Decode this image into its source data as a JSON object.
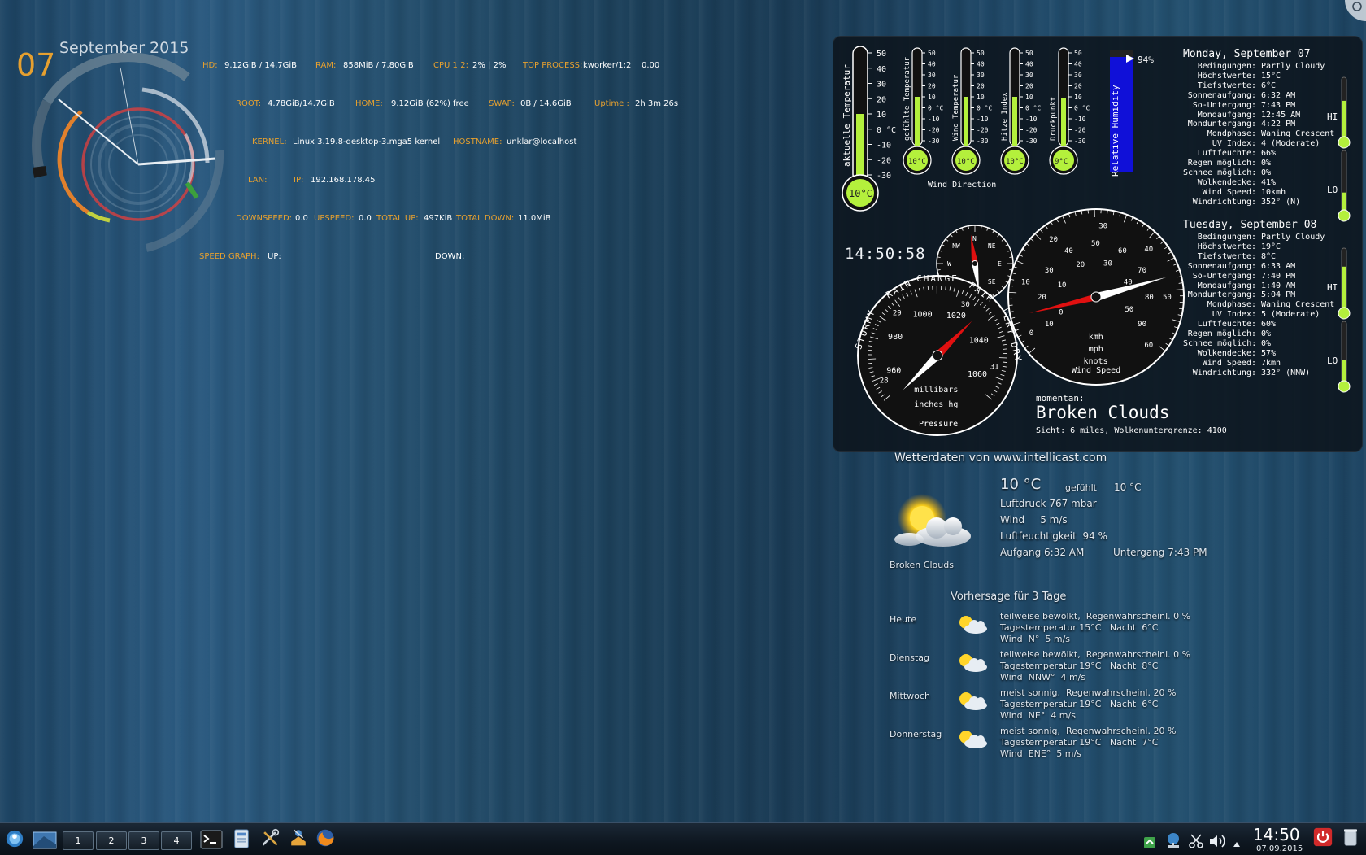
{
  "desktop": {
    "calendar": {
      "day": "07",
      "month_year": "September 2015"
    },
    "sysinfo": {
      "row1": [
        {
          "label": "HD:",
          "value": "9.12GiB / 14.7GiB"
        },
        {
          "label": "RAM:",
          "value": "858MiB / 7.80GiB"
        },
        {
          "label": "CPU 1|2:",
          "value": "2% | 2%"
        },
        {
          "label": "TOP PROCESS:",
          "value": "kworker/1:2",
          "extra": "0.00"
        }
      ],
      "row2": [
        {
          "label": "ROOT:",
          "value": "4.78GiB/14.7GiB"
        },
        {
          "label": "HOME:",
          "value": "9.12GiB (62%) free"
        },
        {
          "label": "SWAP:",
          "value": "0B / 14.6GiB"
        },
        {
          "label": "Uptime :",
          "value": "2h 3m 26s"
        }
      ],
      "row3": [
        {
          "label": "KERNEL:",
          "value": "Linux 3.19.8-desktop-3.mga5 kernel"
        },
        {
          "label": "HOSTNAME:",
          "value": "unklar@localhost"
        }
      ],
      "row4": [
        {
          "label": "LAN:",
          "value": ""
        },
        {
          "label": "IP:",
          "value": "192.168.178.45"
        }
      ],
      "row5": [
        {
          "label": "DOWNSPEED:",
          "value": "0.0"
        },
        {
          "label": "UPSPEED:",
          "value": "0.0"
        },
        {
          "label": "TOTAL UP:",
          "value": "497KiB"
        },
        {
          "label": "TOTAL DOWN:",
          "value": "11.0MiB"
        }
      ],
      "row6": [
        {
          "label": "SPEED GRAPH:",
          "value": ""
        },
        {
          "label": "UP:",
          "value": ""
        },
        {
          "label": "DOWN:",
          "value": ""
        }
      ]
    }
  },
  "weather_station": {
    "thermometers": [
      {
        "label": "aktuelle Temperatur",
        "reading": "10°C",
        "value": 10
      },
      {
        "label": "gefühlte Temperatur",
        "reading": "10°C",
        "value": 10
      },
      {
        "label": "Wind Temperatur",
        "reading": "10°C",
        "value": 10
      },
      {
        "label": "Hitze Index",
        "reading": "10°C",
        "value": 10
      },
      {
        "label": "Druckpunkt",
        "reading": "9°C",
        "value": 9
      }
    ],
    "thermo_scale": [
      "50",
      "40",
      "30",
      "20",
      "10",
      "0 °C",
      "-10",
      "-20",
      "-30"
    ],
    "big_thermo_scale": [
      "50",
      "40",
      "30",
      "20",
      "10",
      "0 °C",
      "-10",
      "-20",
      "-30"
    ],
    "humidity": {
      "label": "Relative Humidity",
      "reading": "94%",
      "value": 94
    },
    "clock": "14:50:58",
    "compass": {
      "title": "Wind Direction",
      "points": [
        "N",
        "NE",
        "E",
        "SE",
        "S",
        "SW",
        "W",
        "NW"
      ],
      "direction_deg": 352
    },
    "wind_speed": {
      "title": "Wind Speed",
      "units": [
        "kmh",
        "mph",
        "knots"
      ],
      "outer_scale": [
        "0",
        "10",
        "20",
        "30",
        "40",
        "50",
        "60"
      ],
      "mid_scale": [
        "10",
        "20",
        "30",
        "40",
        "50",
        "60",
        "70",
        "80",
        "90"
      ],
      "inner_scale": [
        "0",
        "10",
        "20",
        "30",
        "40",
        "50"
      ]
    },
    "pressure": {
      "title": "Pressure",
      "arc_words": [
        "STORMY",
        "RAIN",
        "CHANGE",
        "FAIR",
        "VERY DRY"
      ],
      "mb_scale": [
        "960",
        "980",
        "1000",
        "1020",
        "1040",
        "1060"
      ],
      "inhg_scale": [
        "28",
        "29",
        "30",
        "31"
      ],
      "units": [
        "millibars",
        "inches hg"
      ],
      "value_mb": 1015
    },
    "current": {
      "prefix": "momentan:",
      "condition": "Broken Clouds",
      "detail": "Sicht: 6 miles, Wolkenuntergrenze: 4100"
    },
    "forecast_days": [
      {
        "heading": "Monday, September 07",
        "rows": [
          {
            "k": "Bedingungen:",
            "v": "Partly Cloudy"
          },
          {
            "k": "Höchstwerte:",
            "v": "15°C"
          },
          {
            "k": "Tiefstwerte:",
            "v": "6°C"
          },
          {
            "k": "Sonnenaufgang:",
            "v": "6:32 AM"
          },
          {
            "k": "So-Untergang:",
            "v": "7:43 PM"
          },
          {
            "k": "Mondaufgang:",
            "v": "12:45 AM"
          },
          {
            "k": "Monduntergang:",
            "v": "4:22 PM"
          },
          {
            "k": "Mondphase:",
            "v": "Waning Crescent"
          },
          {
            "k": "UV Index:",
            "v": "4 (Moderate)"
          },
          {
            "k": "Luftfeuchte:",
            "v": "66%"
          },
          {
            "k": "Regen möglich:",
            "v": "0%"
          },
          {
            "k": "Schnee möglich:",
            "v": "0%"
          },
          {
            "k": "Wolkendecke:",
            "v": "41%"
          },
          {
            "k": "Wind Speed:",
            "v": "10kmh"
          },
          {
            "k": "Windrichtung:",
            "v": "352° (N)"
          }
        ],
        "hi_label": "HI",
        "lo_label": "LO",
        "hi_fill": 0.62,
        "lo_fill": 0.32
      },
      {
        "heading": "Tuesday, September 08",
        "rows": [
          {
            "k": "Bedingungen:",
            "v": "Partly Cloudy"
          },
          {
            "k": "Höchstwerte:",
            "v": "19°C"
          },
          {
            "k": "Tiefstwerte:",
            "v": "8°C"
          },
          {
            "k": "Sonnenaufgang:",
            "v": "6:33 AM"
          },
          {
            "k": "So-Untergang:",
            "v": "7:40 PM"
          },
          {
            "k": "Mondaufgang:",
            "v": "1:40 AM"
          },
          {
            "k": "Monduntergang:",
            "v": "5:04 PM"
          },
          {
            "k": "Mondphase:",
            "v": "Waning Crescent"
          },
          {
            "k": "UV Index:",
            "v": "5 (Moderate)"
          },
          {
            "k": "Luftfeuchte:",
            "v": "60%"
          },
          {
            "k": "Regen möglich:",
            "v": "0%"
          },
          {
            "k": "Schnee möglich:",
            "v": "0%"
          },
          {
            "k": "Wolkendecke:",
            "v": "57%"
          },
          {
            "k": "Wind Speed:",
            "v": "7kmh"
          },
          {
            "k": "Windrichtung:",
            "v": "332° (NNW)"
          }
        ],
        "hi_label": "HI",
        "lo_label": "LO",
        "hi_fill": 0.7,
        "lo_fill": 0.38
      }
    ]
  },
  "weather_widget": {
    "source": "Wetterdaten von www.intellicast.com",
    "temp": "10 °C",
    "feels_label": "gefühlt",
    "feels_value": "10 °C",
    "pressure": "Luftdruck  767 mbar",
    "wind": "Wind     5 m/s",
    "humidity": "Luftfeuchtigkeit  94 %",
    "sunrise": "Aufgang 6:32 AM",
    "sunset": "Untergang 7:43 PM",
    "condition": "Broken Clouds",
    "forecast_title": "Vorhersage für 3 Tage",
    "forecast": [
      {
        "day": "Heute",
        "l1": "teilweise bewölkt,  Regenwahrscheinl. 0 %",
        "l2": "Tagestemperatur 15°C   Nacht  6°C",
        "l3": "Wind  N°  5 m/s"
      },
      {
        "day": "Dienstag",
        "l1": "teilweise bewölkt,  Regenwahrscheinl. 0 %",
        "l2": "Tagestemperatur 19°C   Nacht  8°C",
        "l3": "Wind  NNW°  4 m/s"
      },
      {
        "day": "Mittwoch",
        "l1": "meist sonnig,  Regenwahrscheinl. 20 %",
        "l2": "Tagestemperatur 19°C   Nacht  6°C",
        "l3": "Wind  NE°  4 m/s"
      },
      {
        "day": "Donnerstag",
        "l1": "meist sonnig,  Regenwahrscheinl. 20 %",
        "l2": "Tagestemperatur 19°C   Nacht  7°C",
        "l3": "Wind  ENE°  5 m/s"
      }
    ]
  },
  "taskbar": {
    "desktops": [
      "1",
      "2",
      "3",
      "4"
    ],
    "active_desktop": 0,
    "clock_time": "14:50",
    "clock_date": "07.09.2015",
    "launchers": [
      "terminal-icon",
      "file-manager-icon",
      "system-settings-icon",
      "software-manager-icon",
      "firefox-icon"
    ],
    "tray": [
      "update-icon",
      "network-icon",
      "clipboard-icon",
      "volume-icon",
      "tray-expand-icon"
    ]
  },
  "colors": {
    "accent_orange": "#e6a02f",
    "gauge_green": "#b4f03c",
    "needle_red": "#e01010",
    "humidity_blue": "#1010d8"
  }
}
